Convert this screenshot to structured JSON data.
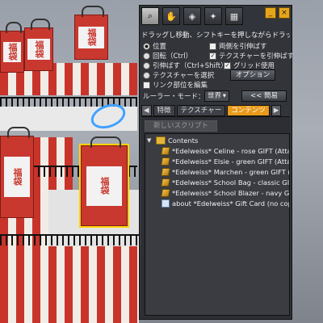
{
  "scene": {
    "bag_text": "福袋"
  },
  "window": {
    "minimize_label": "_",
    "close_label": "×",
    "tools": [
      {
        "icon": "magnifier-icon"
      },
      {
        "icon": "grab-icon"
      },
      {
        "icon": "create-cube-icon"
      },
      {
        "icon": "wand-icon"
      },
      {
        "icon": "land-icon"
      }
    ],
    "hint": "ドラッグし移動、シフトキーを押しながらドラッグしてコピー",
    "options": {
      "move": "位置",
      "rotate": "回転（Ctrl）",
      "stretch": "引伸ばす（Ctrl+Shift）",
      "select_texture": "テクスチャーを選択",
      "stretch_both": "両側を引伸ばす",
      "stretch_textures": "テクスチャーを引伸ばす",
      "use_grid": "グリッド使用",
      "options_button": "オプション",
      "edit_linked": "リンク部位を編集",
      "ruler_mode_label": "ルーラー・モード：",
      "ruler_mode_value": "世界",
      "simple_button": "<< 簡易"
    },
    "tabs": [
      "特徴",
      "テクスチャー",
      "コンテンツ"
    ],
    "tab_prev": "◀",
    "tab_next": "▶",
    "contents": {
      "new_script": "新しいスクリプト",
      "folder": "Contents",
      "items": [
        "*Edelweiss* Celine - rose GIFT (Attach",
        "*Edelweiss* Elsie - green GIFT (Attach",
        "*Edelweiss* Marchen - green GIFT (A",
        "*Edelweiss* School Bag - classic GIFT",
        "*Edelweiss* School Blazer - navy GIFT",
        "about *Edelweiss* Gift Card (no copy)"
      ]
    }
  }
}
